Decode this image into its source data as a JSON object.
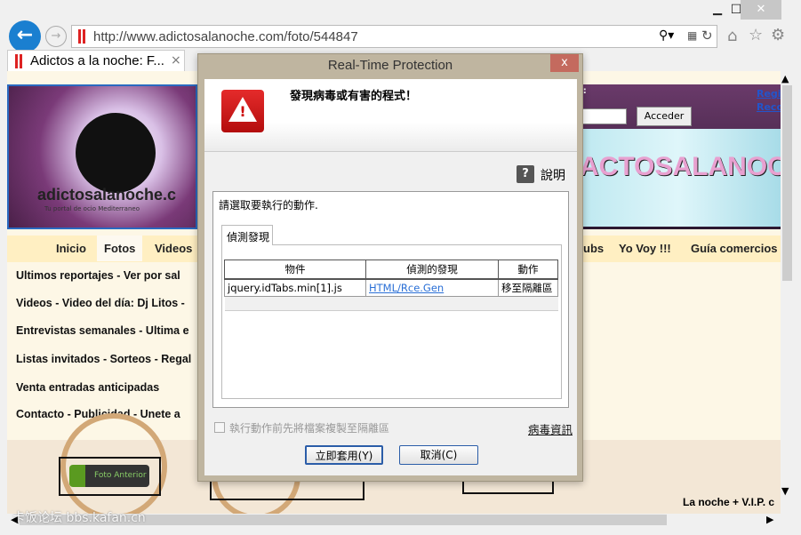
{
  "browser": {
    "url": "http://www.adictosalanoche.com/foto/544847",
    "tab_title": "Adictos a la noche: F...",
    "tab_close": "×",
    "window_controls": {
      "minimize": "▁",
      "maximize": "☐",
      "close": "✕"
    },
    "icons": [
      "back-arrow-icon",
      "forward-arrow-icon",
      "search-icon",
      "compat-view-icon",
      "refresh-icon",
      "home-icon",
      "favorites-star-icon",
      "settings-gear-icon"
    ]
  },
  "page": {
    "logo_text": "adictosalanoche.com",
    "logo_sub": "Tu portal de ocio Mediterraneo",
    "banner_title": "ACTOSALANOCHE",
    "login_label": "a:",
    "login_button": "Acceder",
    "top_links": [
      "Regis",
      "Reco"
    ],
    "nav": [
      "Inicio",
      "Fotos",
      "Videos",
      "ubs",
      "Yo Voy !!!",
      "Guía comercios"
    ],
    "menu": [
      "Ultimos reportajes  -  Ver por sal",
      "Videos  -  Video del día: Dj Litos -",
      "Entrevistas semanales  - Ultima e",
      "Listas invitados - Sorteos - Regal",
      "Venta entradas anticipadas",
      "Contacto  -  Publicidad  -  Unete a"
    ],
    "foto_anterior": "Foto Anterior",
    "footer_text": "La noche + V.I.P. c",
    "watermark": "卡饭论坛 bbs.kafan.cn"
  },
  "dialog": {
    "title": "Real-Time Protection",
    "close": "x",
    "header_message": "發現病毒或有害的程式！",
    "help_label": "說明",
    "instruction": "請選取要執行的動作.",
    "tab": "偵測發現",
    "table": {
      "columns": [
        "物件",
        "偵測的發現",
        "動作"
      ],
      "rows": [
        [
          "jquery.idTabs.min[1].js",
          "HTML/Rce.Gen",
          "移至隔離區"
        ]
      ]
    },
    "checkbox_label": "執行動作前先將檔案複製至隔離區",
    "checkbox_checked": false,
    "virus_info_link": "病毒資訊",
    "apply_button": "立即套用(Y)",
    "cancel_button": "取消(C)",
    "accent_color": "#d32020"
  }
}
